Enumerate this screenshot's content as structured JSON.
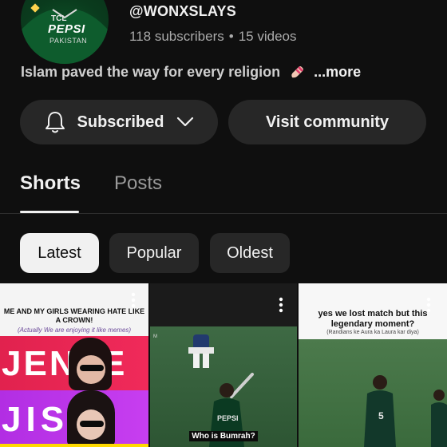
{
  "channel": {
    "handle": "@WONXSLAYS",
    "subscribers": "118 subscribers",
    "separator": "•",
    "videos": "15 videos",
    "avatar_text": {
      "brand": "TCL",
      "sponsor": "PEPSI",
      "country": "PAKISTAN"
    }
  },
  "bio": {
    "text": "Islam paved the way for every religion",
    "more": "...more"
  },
  "actions": {
    "subscribed_label": "Subscribed",
    "visit_label": "Visit community"
  },
  "tabs": [
    {
      "label": "Shorts",
      "active": true
    },
    {
      "label": "Posts",
      "active": false
    }
  ],
  "chips": [
    {
      "label": "Latest",
      "active": true
    },
    {
      "label": "Popular"
    },
    {
      "label": "Oldest"
    }
  ],
  "shorts": [
    {
      "caption": "ME AND MY GIRLS WEARING HATE LIKE A CROWN!",
      "subcaption": "(Actually We are enjoying it like memes)",
      "big_text_1": "JEN IE",
      "big_text_2": "JIS O"
    },
    {
      "overlay": "Who is Bumrah?",
      "jersey": "PEPSI"
    },
    {
      "caption": "yes we lost match but this legendary moment?",
      "subcaption": "(Randians ke Aura ka Laura kar diya)"
    }
  ],
  "colors": {
    "background": "#0f0f0f",
    "pill": "#272727",
    "text": "#f1f1f1",
    "muted": "#aaaaaa"
  }
}
